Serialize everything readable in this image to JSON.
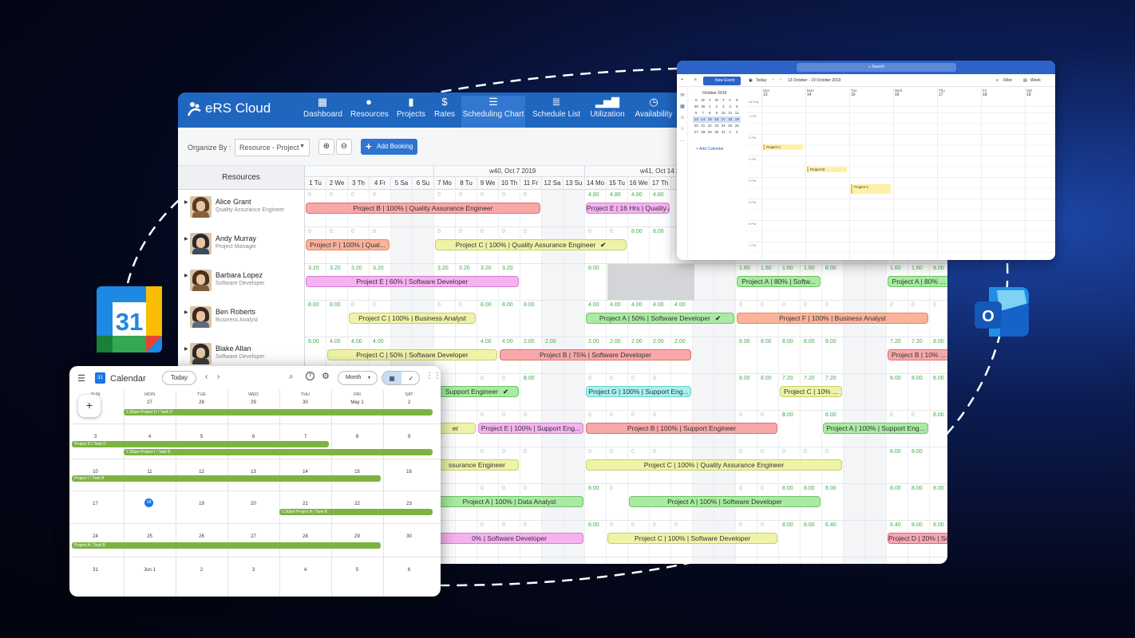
{
  "ers": {
    "logo": "eRS Cloud",
    "nav": [
      "Dashboard",
      "Resources",
      "Projects",
      "Rates",
      "Scheduling Chart",
      "Schedule List",
      "Utilization",
      "Availability"
    ],
    "organize_label": "Organize By :",
    "organize_value": "Resource - Project",
    "add_booking": "Add Booking",
    "resources_header": "Resources",
    "week1": "w40, Oct 7 2019",
    "week2": "w41, Oct 14 2019",
    "days": [
      "1 Tu",
      "2 We",
      "3 Th",
      "4 Fr",
      "5 Sa",
      "6 Su",
      "7 Mo",
      "8 Tu",
      "9 We",
      "10 Th",
      "11 Fr",
      "12 Sa",
      "13 Su",
      "14 Mo",
      "15 Tu",
      "16 We",
      "17 Th"
    ],
    "resources": [
      {
        "name": "Alice Grant",
        "role": "Quality Assurance Engineer"
      },
      {
        "name": "Andy Murray",
        "role": "Project Manager"
      },
      {
        "name": "Barbara Lopez",
        "role": "Software Developer"
      },
      {
        "name": "Ben Roberts",
        "role": "Business Analyst"
      },
      {
        "name": "Blake Allan",
        "role": "Software Developer"
      }
    ],
    "bookings": {
      "b1": "Project B | 100% | Quality Assurance Engineer",
      "b2": "Project E | 16 Hrs | Quality A",
      "b3": "Project F | 100% | Qual...",
      "b4": "Project C | 100% | Quality Assurance Engineer",
      "b5": "Project E | 60% | Software Developer",
      "b6": "Project A | 80% | Softw...",
      "b7": "Project A | 80% ...",
      "b8": "Project C | 100% | Business Analyst",
      "b9": "Project A | 50% | Software Developer",
      "b10": "Project F | 100% | Business Analyst",
      "b11": "Project C | 50% | Software Developer",
      "b12": "Project B | 75% | Software Developer",
      "b13": "Project B | 10% ...",
      "b14": "Support Engineer",
      "b15": "Project G | 100% | Support Eng...",
      "b16": "Project C | 10% ...",
      "b17": "er",
      "b18": "Project E | 100% | Support Eng...",
      "b19": "Project B | 100% | Support Engineer",
      "b20": "Project A | 100% | Support Eng...",
      "b21": "ssurance Engineer",
      "b22": "Project C | 100% | Quality Assurance Engineer",
      "b23": "Project A | 100% | Data Analyst",
      "b24": "Project A | 100% | Software Developer",
      "b25": "0% | Software Developer",
      "b26": "Project C | 100% | Software Developer",
      "b27": "Project D | 20% | Softw..."
    }
  },
  "outlook": {
    "search": "Search",
    "new_event": "New Event",
    "today": "Today",
    "range": "13 October - 19 October 2019",
    "filter": "Filter",
    "view": "Week",
    "mini_title": "October 2019",
    "add_calendar": "Add Calendar",
    "all_day": "All Day",
    "times": [
      "1 PM",
      "2 PM",
      "3 PM",
      "4 PM",
      "5 PM",
      "6 PM",
      "7 PM"
    ],
    "days": [
      {
        "dn": "Sun",
        "d": "13"
      },
      {
        "dn": "Mon",
        "d": "14"
      },
      {
        "dn": "Tue",
        "d": "15"
      },
      {
        "dn": "Wed",
        "d": "16"
      },
      {
        "dn": "Thu",
        "d": "17"
      },
      {
        "dn": "Fri",
        "d": "18"
      },
      {
        "dn": "Sat",
        "d": "19"
      }
    ],
    "events": [
      "Project A",
      "Project B",
      "Project C"
    ]
  },
  "gcal": {
    "title": "Calendar",
    "today": "Today",
    "view": "Month",
    "daynames": [
      "SUN",
      "MON",
      "TUE",
      "WED",
      "THU",
      "FRI",
      "SAT"
    ],
    "events": {
      "e1": "1:30pm Project D / Task D",
      "e2": "Project D / Task D",
      "e3": "1:30pm Project I / Task B",
      "e4": "Project I / Task B",
      "e5": "1:30pm Project A / Task B",
      "e6": "Project A / Task B"
    }
  },
  "icons": {
    "google_calendar_day": "31",
    "outlook_letter": "O"
  },
  "colors": {
    "ers_blue": "#1f66bf",
    "outlook_blue": "#2b63c9",
    "gcal_green": "#7cb342"
  }
}
